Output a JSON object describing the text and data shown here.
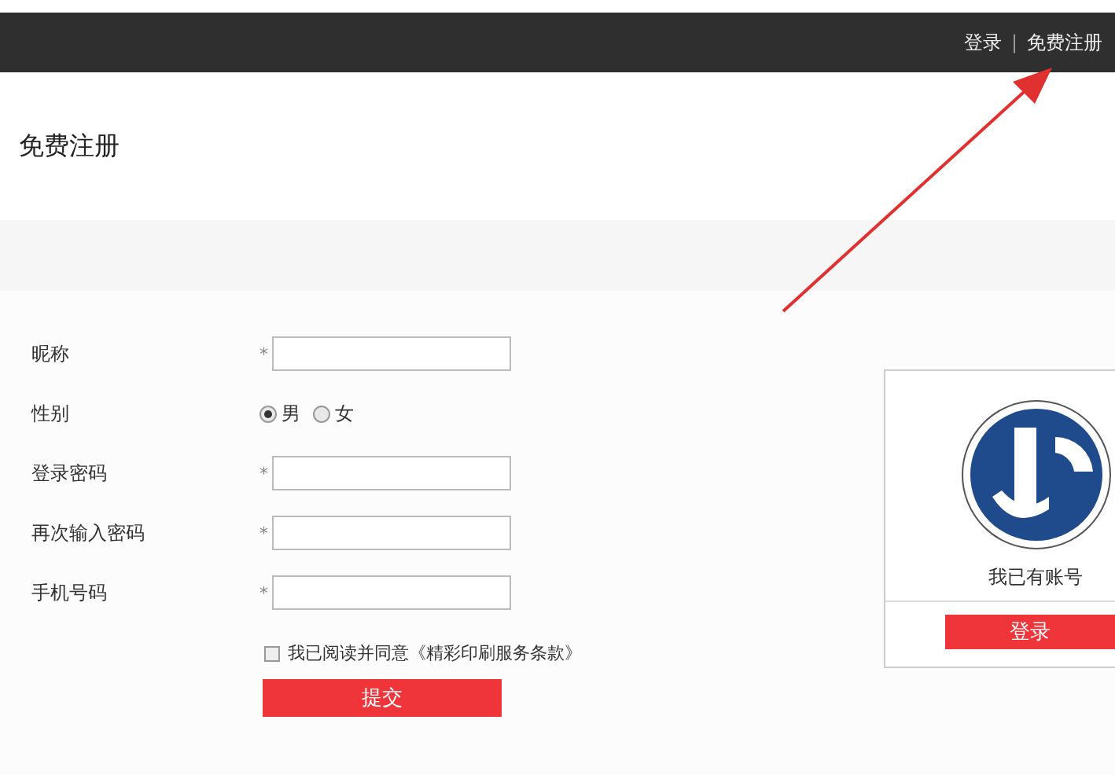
{
  "top_bar": {
    "links": [
      {
        "label": "登录"
      },
      {
        "label": "免费注册"
      }
    ],
    "separator": "|"
  },
  "page_title": "免费注册",
  "form": {
    "fields": [
      {
        "kind": "text",
        "label": "昵称",
        "required_mark": "*"
      },
      {
        "kind": "radio",
        "label": "性别",
        "options": [
          {
            "label": "男",
            "selected": true
          },
          {
            "label": "女",
            "selected": false
          }
        ]
      },
      {
        "kind": "text",
        "label": "登录密码",
        "required_mark": "*"
      },
      {
        "kind": "text",
        "label": "再次输入密码",
        "required_mark": "*"
      },
      {
        "kind": "text",
        "label": "手机号码",
        "required_mark": "*"
      }
    ],
    "agreement": {
      "text": "我已阅读并同意《精彩印刷服务条款》",
      "checked": false
    },
    "submit": "提交"
  },
  "login_card": {
    "prompt": "我已有账号",
    "button": "登录"
  },
  "annotation": {
    "kind": "arrow"
  }
}
